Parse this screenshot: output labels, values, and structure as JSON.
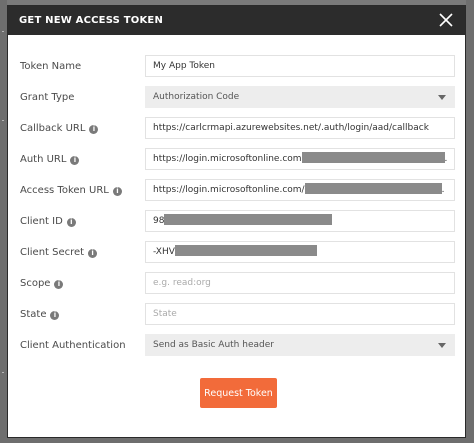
{
  "dialog": {
    "title": "GET NEW ACCESS TOKEN",
    "close_icon": "close-icon"
  },
  "fields": {
    "token_name": {
      "label": "Token Name",
      "value": "My App Token"
    },
    "grant_type": {
      "label": "Grant Type",
      "value": "Authorization Code"
    },
    "callback_url": {
      "label": "Callback URL",
      "value": "https://carlcrmapi.azurewebsites.net/.auth/login/aad/callback"
    },
    "auth_url": {
      "label": "Auth URL",
      "value": "https://login.microsoftonline.com",
      "suffix": "."
    },
    "access_token_url": {
      "label": "Access Token URL",
      "value": "https://login.microsoftonline.com/",
      "suffix": "."
    },
    "client_id": {
      "label": "Client ID",
      "value": "98"
    },
    "client_secret": {
      "label": "Client Secret",
      "value": "-XHV"
    },
    "scope": {
      "label": "Scope",
      "placeholder": "e.g. read:org"
    },
    "state": {
      "label": "State",
      "placeholder": "State"
    },
    "client_auth": {
      "label": "Client Authentication",
      "value": "Send as Basic Auth header"
    }
  },
  "actions": {
    "request_token": "Request Token"
  },
  "colors": {
    "header": "#2c2c2c",
    "accent": "#f26b3a",
    "select_bg": "#ededed",
    "redaction": "#8a8a8a"
  }
}
